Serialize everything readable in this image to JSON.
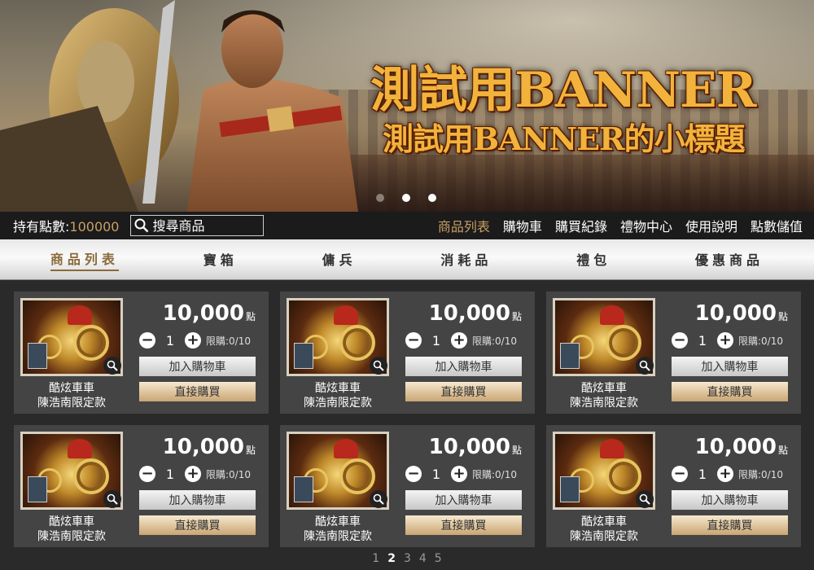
{
  "banner": {
    "title": "測試用BANNER",
    "subtitle": "測試用BANNER的小標題",
    "slides": 3,
    "active_slide": 2
  },
  "topbar": {
    "points_label": "持有點數:",
    "points_value": "100000",
    "search_placeholder": "搜尋商品",
    "nav": [
      "商品列表",
      "購物車",
      "購買紀錄",
      "禮物中心",
      "使用說明",
      "點數儲值"
    ],
    "active_nav": "商品列表"
  },
  "categories": [
    "商品列表",
    "寶箱",
    "傭兵",
    "消耗品",
    "禮包",
    "優惠商品"
  ],
  "active_category": "商品列表",
  "products": [
    {
      "name_line1": "酷炫車車",
      "name_line2": "陳浩南限定款",
      "price": "10,000",
      "unit": "點",
      "qty": "1",
      "limit": "限購:0/10",
      "cart_label": "加入購物車",
      "buy_label": "直接購買"
    },
    {
      "name_line1": "酷炫車車",
      "name_line2": "陳浩南限定款",
      "price": "10,000",
      "unit": "點",
      "qty": "1",
      "limit": "限購:0/10",
      "cart_label": "加入購物車",
      "buy_label": "直接購買"
    },
    {
      "name_line1": "酷炫車車",
      "name_line2": "陳浩南限定款",
      "price": "10,000",
      "unit": "點",
      "qty": "1",
      "limit": "限購:0/10",
      "cart_label": "加入購物車",
      "buy_label": "直接購買"
    },
    {
      "name_line1": "酷炫車車",
      "name_line2": "陳浩南限定款",
      "price": "10,000",
      "unit": "點",
      "qty": "1",
      "limit": "限購:0/10",
      "cart_label": "加入購物車",
      "buy_label": "直接購買"
    },
    {
      "name_line1": "酷炫車車",
      "name_line2": "陳浩南限定款",
      "price": "10,000",
      "unit": "點",
      "qty": "1",
      "limit": "限購:0/10",
      "cart_label": "加入購物車",
      "buy_label": "直接購買"
    },
    {
      "name_line1": "酷炫車車",
      "name_line2": "陳浩南限定款",
      "price": "10,000",
      "unit": "點",
      "qty": "1",
      "limit": "限購:0/10",
      "cart_label": "加入購物車",
      "buy_label": "直接購買"
    }
  ],
  "pagination": {
    "pages": [
      "1",
      "2",
      "3",
      "4",
      "5"
    ],
    "current": "2"
  },
  "colors": {
    "accent": "#c9a063",
    "banner_text": "#f2b33c"
  }
}
